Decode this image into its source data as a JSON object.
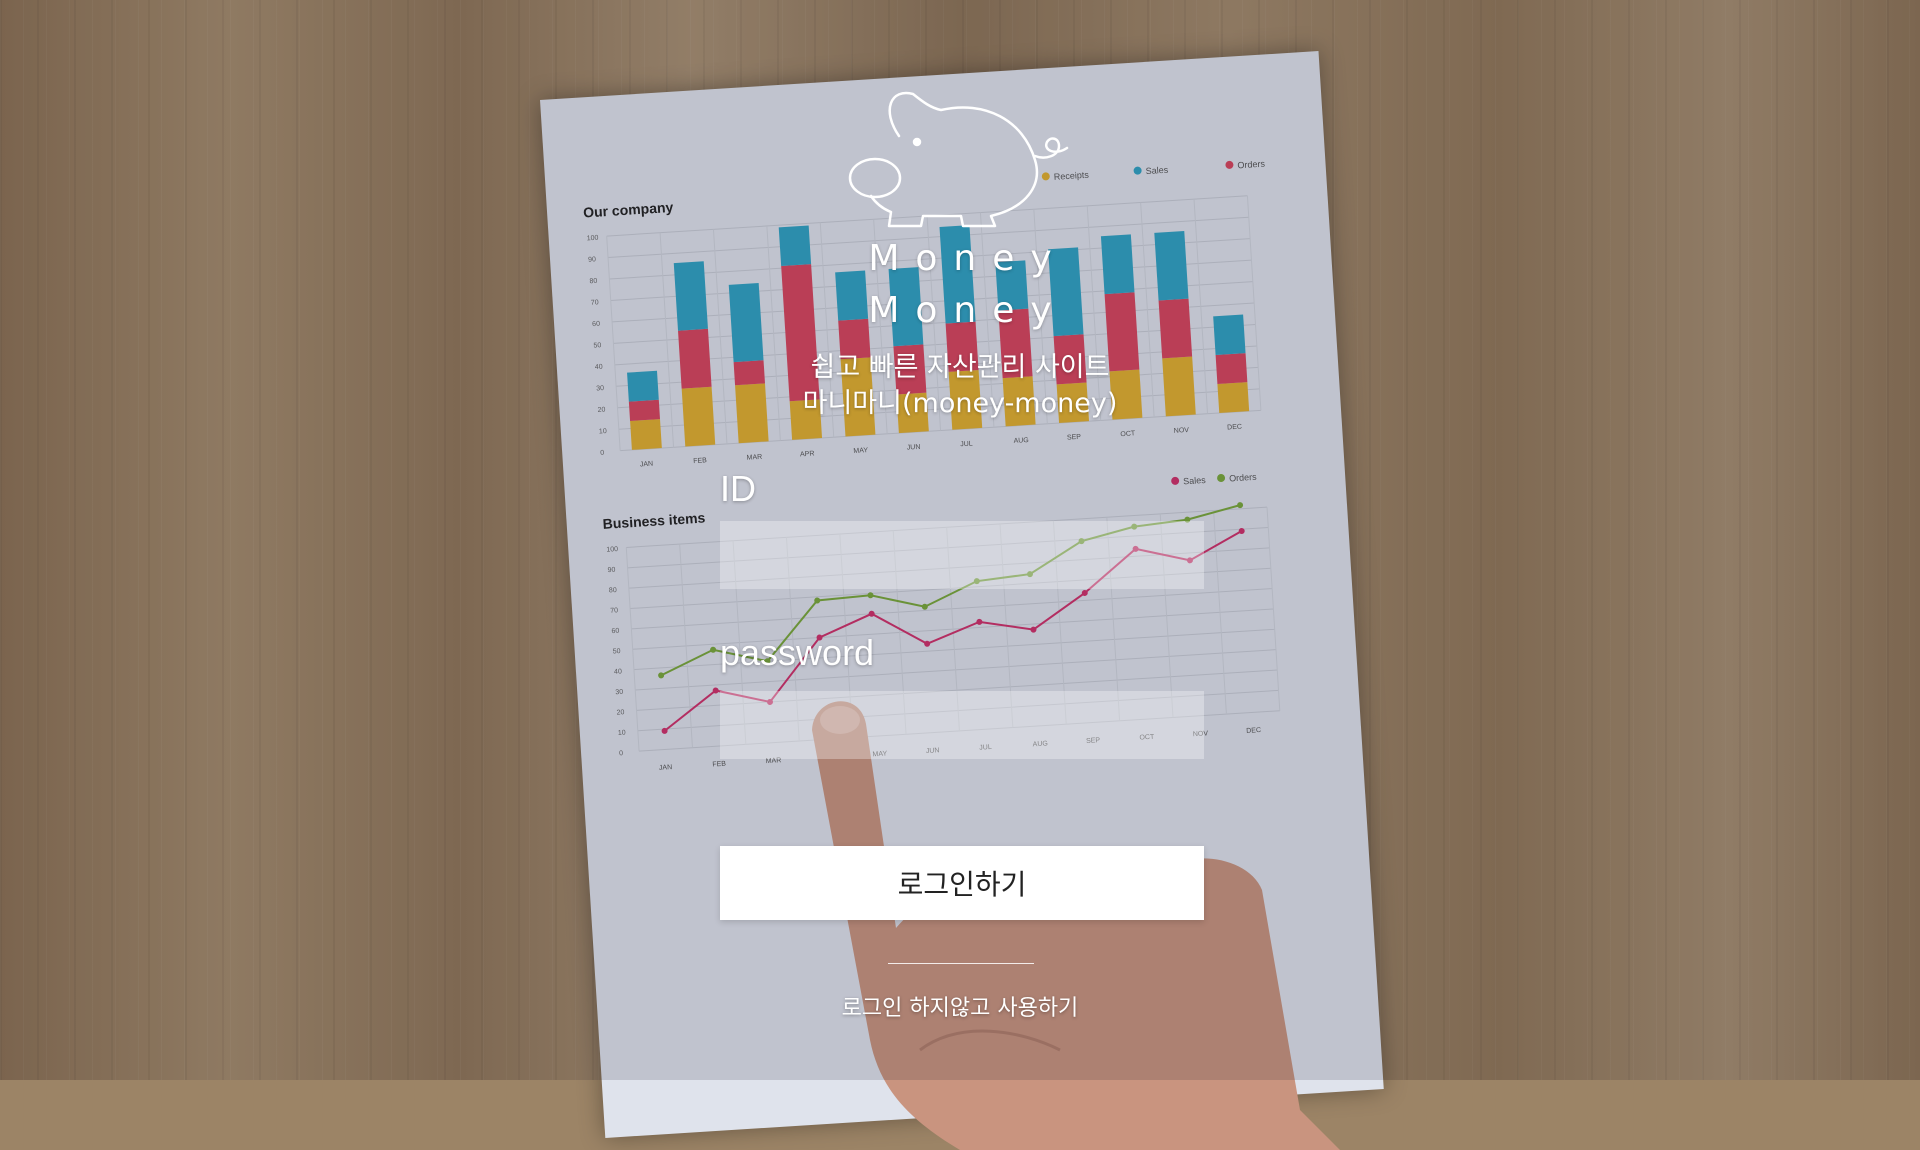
{
  "brand": {
    "line1": "Money",
    "line2": "Money"
  },
  "tagline": {
    "line1": "쉽고 빠른 자산관리 사이트",
    "line2": "마니마니(money-money)"
  },
  "form": {
    "id_label": "ID",
    "id_value": "",
    "password_label": "password",
    "password_value": "",
    "login_label": "로그인하기"
  },
  "guest_link": "로그인 하지않고 사용하기",
  "background": {
    "bar_chart_title": "Our company",
    "bar_legend": [
      "Receipts",
      "Sales",
      "Orders"
    ],
    "months": [
      "JAN",
      "FEB",
      "MAR",
      "APR",
      "MAY",
      "JUN",
      "JUL",
      "AUG",
      "SEP",
      "OCT",
      "NOV",
      "DEC"
    ],
    "line_chart_title": "Business items",
    "line_legend": [
      "Sales",
      "Orders"
    ],
    "y_ticks": [
      "100",
      "90",
      "80",
      "70",
      "60",
      "50",
      "40",
      "30",
      "20",
      "10",
      "0"
    ]
  },
  "colors": {
    "receipts": "#e2b02e",
    "sales": "#2fa3c4",
    "orders": "#d8455d",
    "line_sales": "#d0306a",
    "line_orders": "#79a83a"
  }
}
